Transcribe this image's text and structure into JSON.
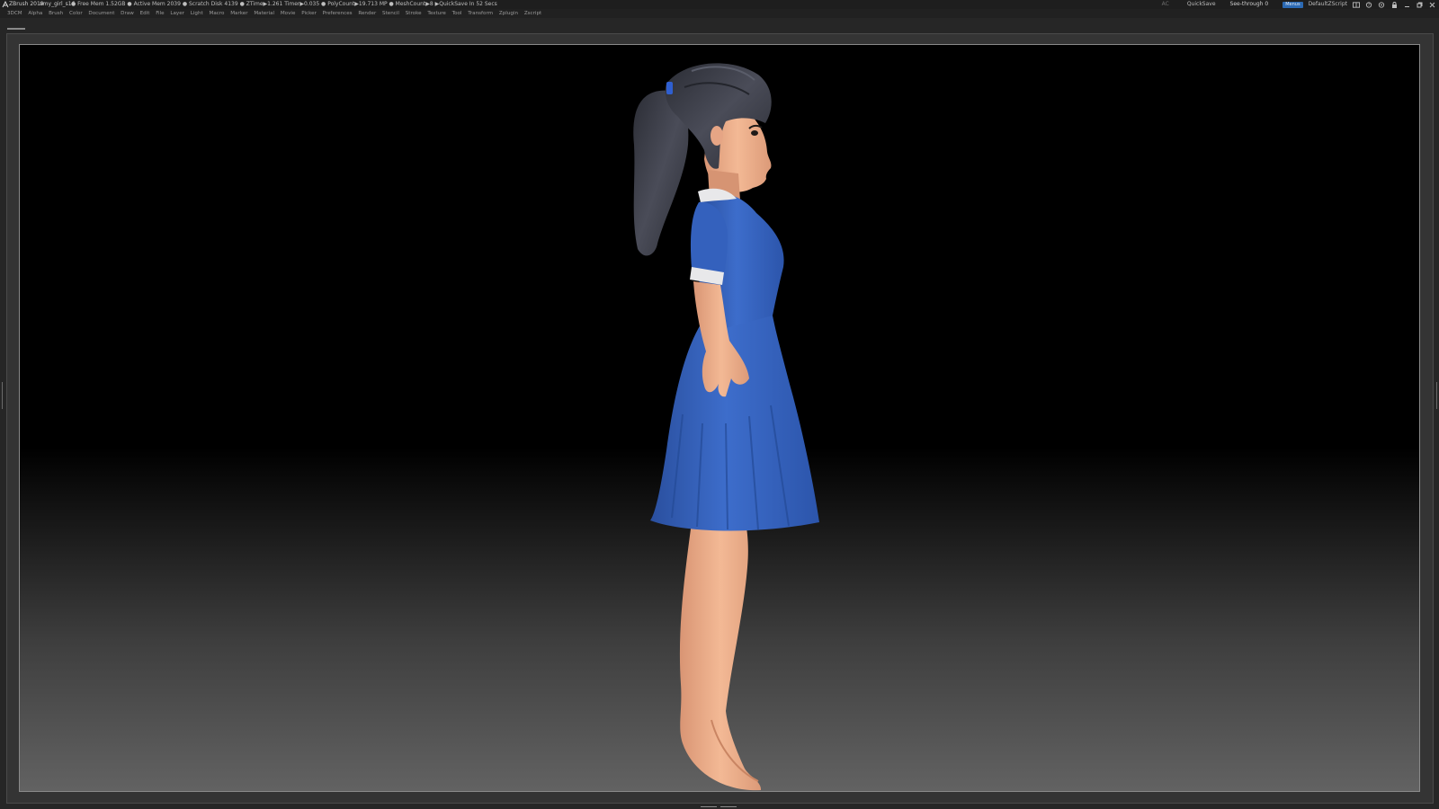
{
  "titlebar": {
    "app_name": "ZBrush 2019",
    "document_name": "amy_girl_s16",
    "stats": "● Free Mem 1.52GB ● Active Mem 2039 ● Scratch Disk 4139 ● ZTime▶1.261 Timer▶0.035 ● PolyCount▶19.713 MP ● MeshCount▶8 ▶QuickSave In 52 Secs",
    "ac_label": "AC",
    "quicksave_label": "QuickSave",
    "see_through_label": "See-through",
    "see_through_value": "0",
    "menus_label": "Menus",
    "script_label": "DefaultZScript",
    "icons": [
      "layout-icon",
      "help-icon",
      "palette-icon",
      "minimize-icon",
      "restore-icon",
      "close-icon"
    ]
  },
  "menubar": {
    "items": [
      "3DCM",
      "Alpha",
      "Brush",
      "Color",
      "Document",
      "Draw",
      "Edit",
      "File",
      "Layer",
      "Light",
      "Macro",
      "Marker",
      "Material",
      "Movie",
      "Picker",
      "Preferences",
      "Render",
      "Stencil",
      "Stroke",
      "Texture",
      "Tool",
      "Transform",
      "Zplugin",
      "Zscript"
    ]
  },
  "viewport": {
    "colors": {
      "dress": "#3a68c4",
      "skin": "#f0b18c",
      "hair": "#3d3f4a",
      "collar": "#e8e8ea",
      "hair_tie": "#2f5fd0"
    }
  }
}
